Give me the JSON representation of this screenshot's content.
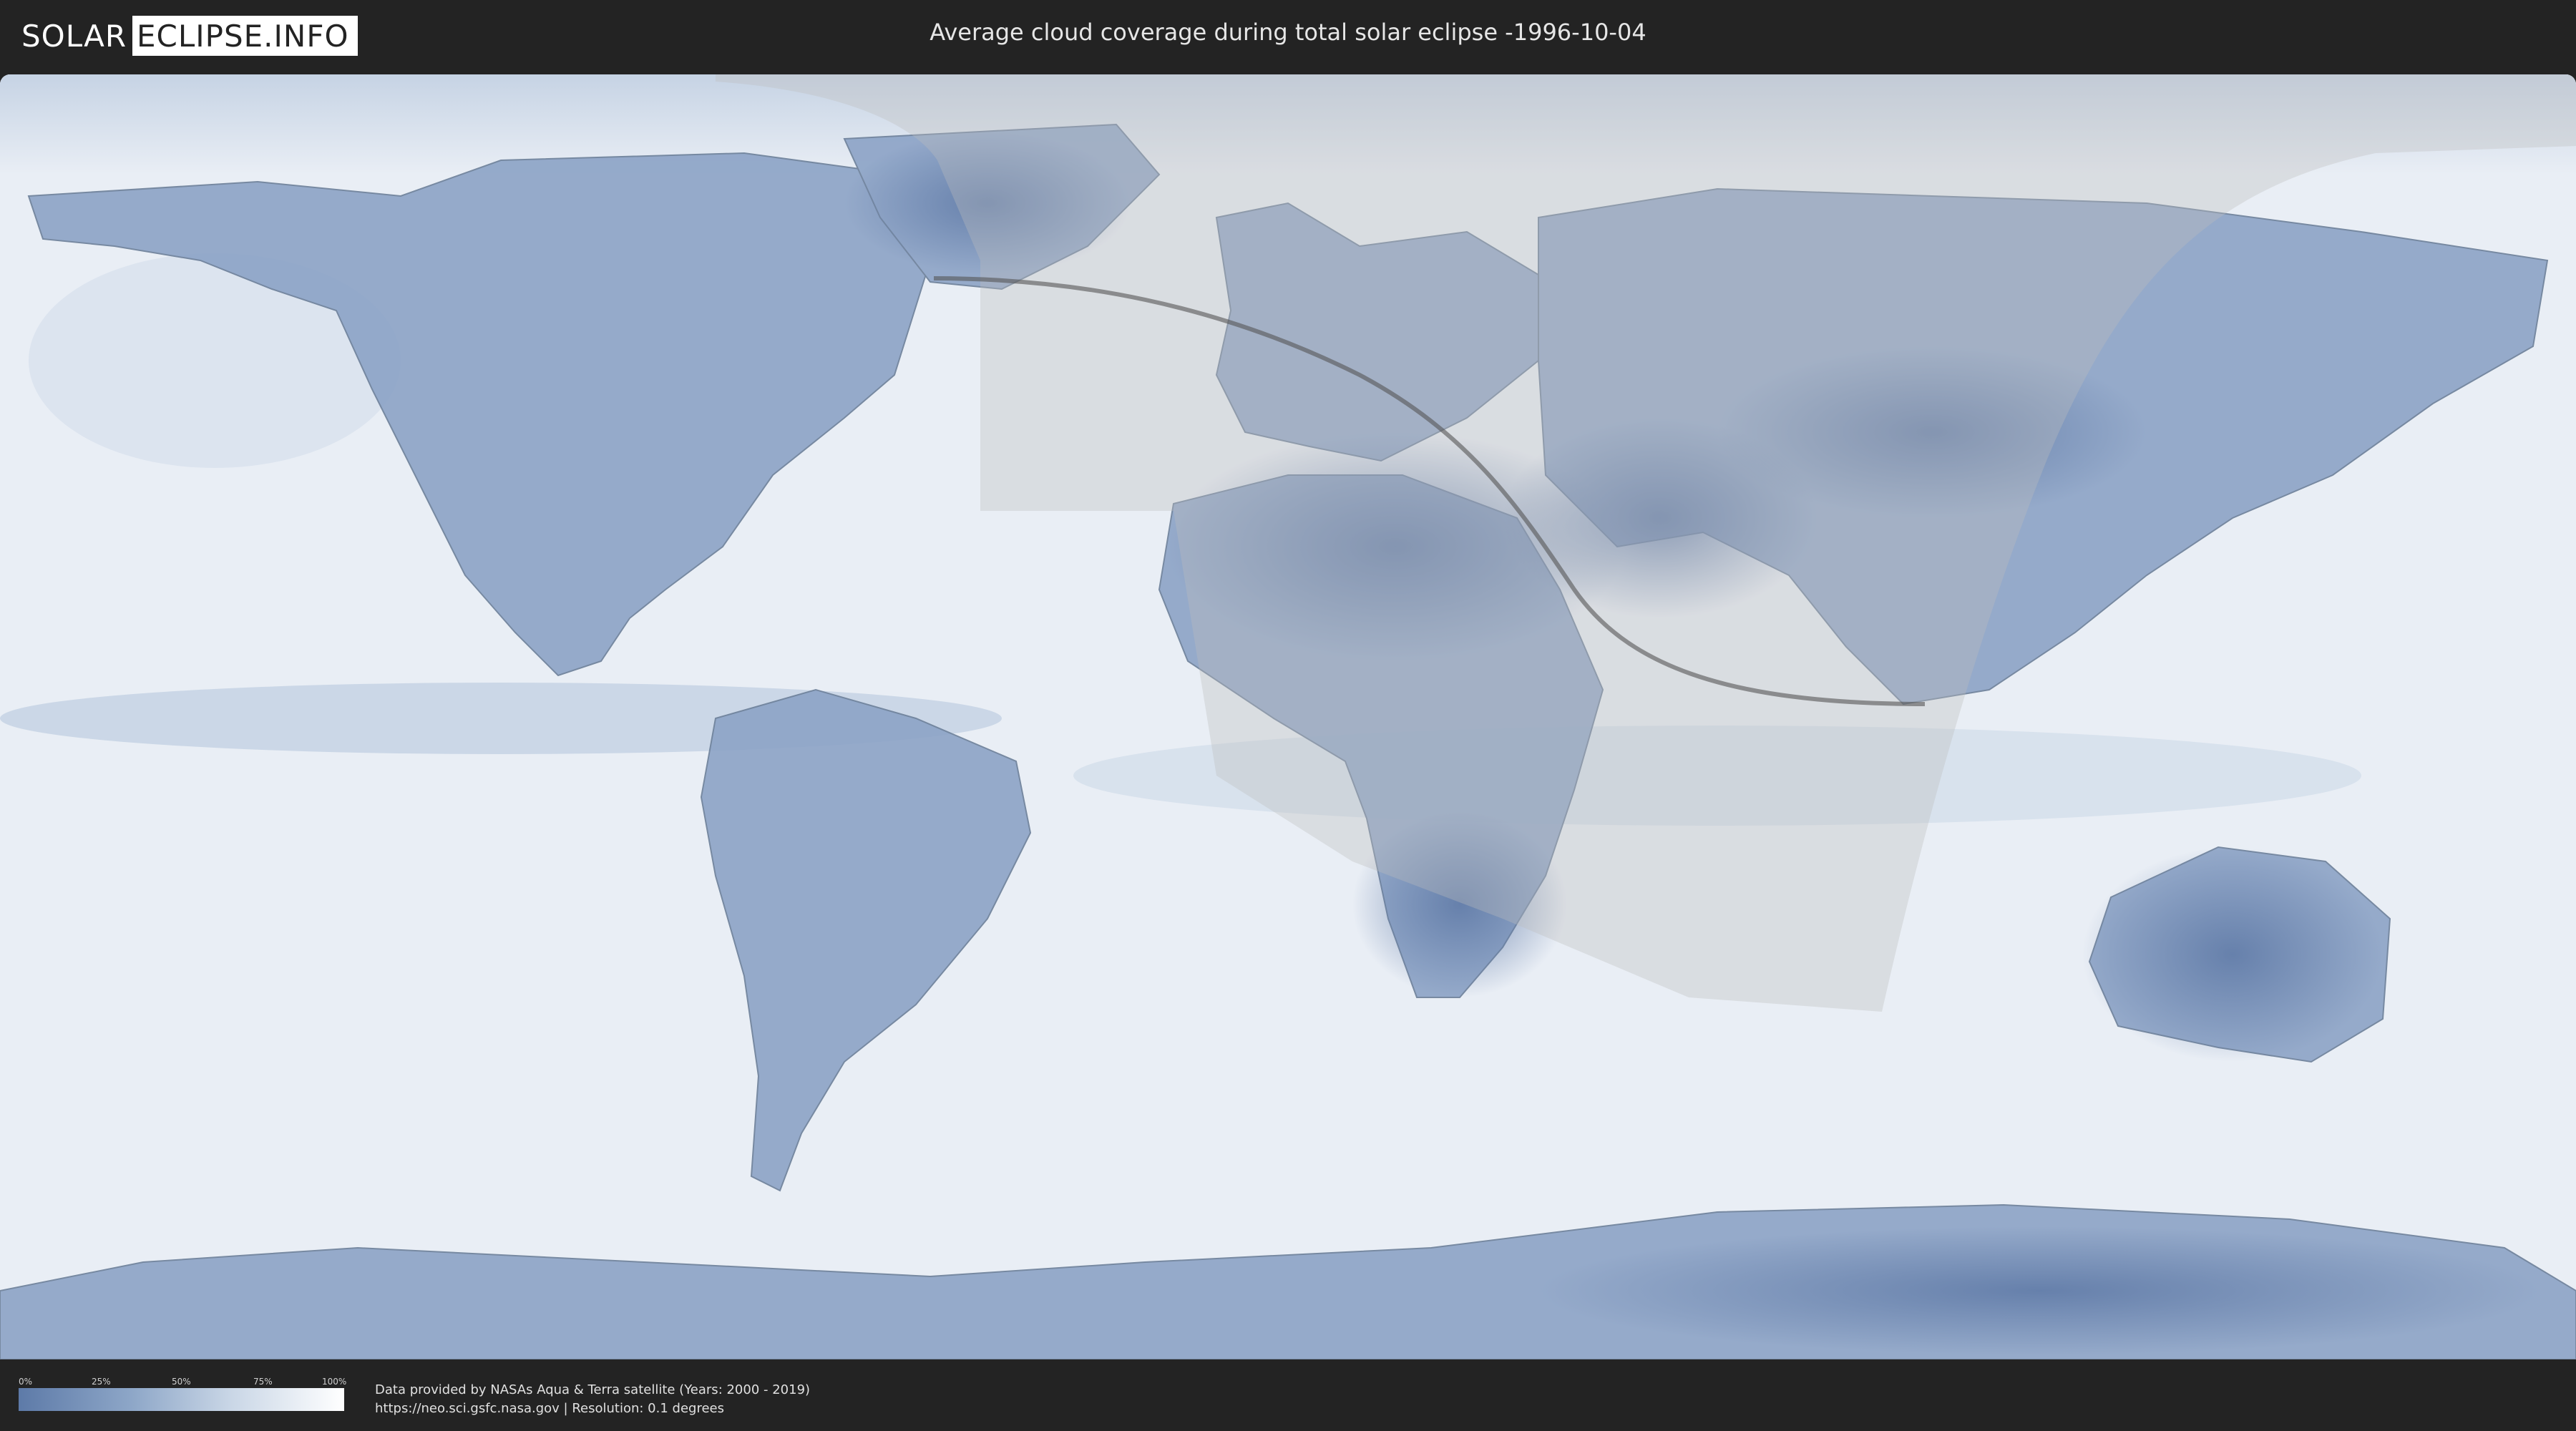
{
  "header": {
    "logo_left": "SOLAR",
    "logo_right": "ECLIPSE.INFO",
    "title": "Average cloud coverage during total solar eclipse -1996-10-04"
  },
  "legend": {
    "ticks": [
      "0%",
      "25%",
      "50%",
      "75%",
      "100%"
    ],
    "gradient_colors": [
      "#5d7aa8",
      "#8ea7c8",
      "#c9d6e6",
      "#ffffff"
    ]
  },
  "footer": {
    "credit_line1": "Data provided by NASAs Aqua & Terra satellite (Years: 2000 - 2019)",
    "credit_line2": "https://neo.sci.gsfc.nasa.gov | Resolution: 0.1 degrees"
  },
  "map": {
    "ocean_color": "#e9eef5",
    "land_low_cloud_color": "#5e79a6",
    "shadow_overlay_color": "#bfbfbf",
    "path_line_color": "#555555"
  }
}
